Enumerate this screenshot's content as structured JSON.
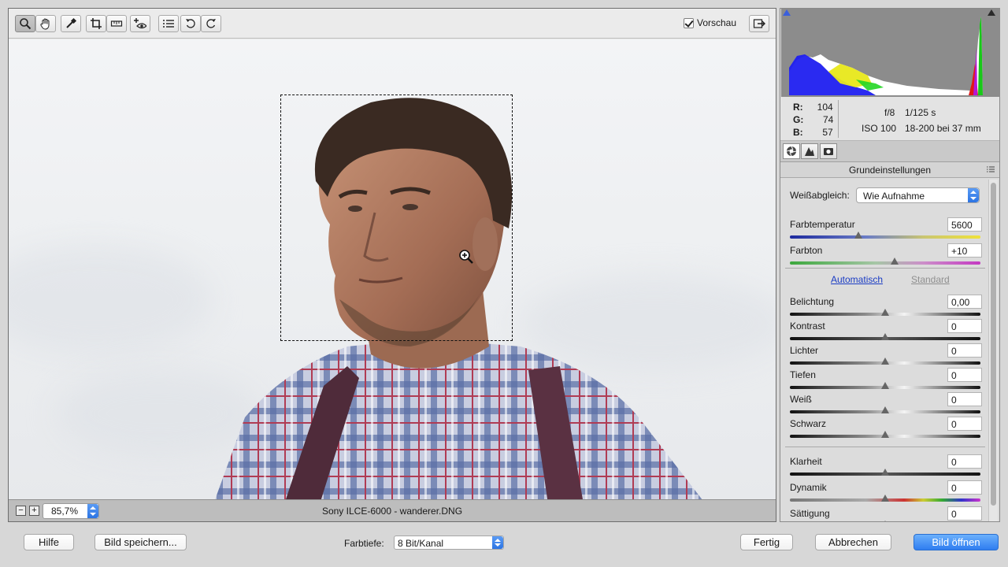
{
  "toolbar": {
    "preview_label": "Vorschau",
    "tools": [
      "zoom-tool",
      "hand-tool",
      "color-sampler-tool",
      "crop-tool",
      "straighten-tool",
      "red-eye-tool",
      "preferences-tool",
      "rotate-ccw-tool",
      "rotate-cw-tool"
    ]
  },
  "statusbar": {
    "zoom_out_label": "−",
    "zoom_in_label": "+",
    "zoom_value": "85,7%",
    "file_info": "Sony ILCE-6000 - wanderer.DNG"
  },
  "info": {
    "r_label": "R:",
    "r_value": "104",
    "g_label": "G:",
    "g_value": "74",
    "b_label": "B:",
    "b_value": "57",
    "aperture": "f/8",
    "shutter": "1/125 s",
    "iso": "ISO 100",
    "lens": "18-200 bei 37 mm"
  },
  "panel": {
    "section_title": "Grundeinstellungen",
    "wb_label": "Weißabgleich:",
    "wb_value": "Wie Aufnahme",
    "auto_label": "Automatisch",
    "default_label": "Standard",
    "sliders": [
      {
        "label": "Farbtemperatur",
        "value": "5600",
        "position": 0.36
      },
      {
        "label": "Farbton",
        "value": "+10",
        "position": 0.55
      },
      {
        "label": "Belichtung",
        "value": "0,00",
        "position": 0.5
      },
      {
        "label": "Kontrast",
        "value": "0",
        "position": 0.5
      },
      {
        "label": "Lichter",
        "value": "0",
        "position": 0.5
      },
      {
        "label": "Tiefen",
        "value": "0",
        "position": 0.5
      },
      {
        "label": "Weiß",
        "value": "0",
        "position": 0.5
      },
      {
        "label": "Schwarz",
        "value": "0",
        "position": 0.5
      },
      {
        "label": "Klarheit",
        "value": "0",
        "position": 0.5
      },
      {
        "label": "Dynamik",
        "value": "0",
        "position": 0.5
      },
      {
        "label": "Sättigung",
        "value": "0",
        "position": 0.5
      }
    ]
  },
  "bottom": {
    "help_label": "Hilfe",
    "save_label": "Bild speichern...",
    "bitdepth_label": "Farbtiefe:",
    "bitdepth_value": "8 Bit/Kanal",
    "done_label": "Fertig",
    "cancel_label": "Abbrechen",
    "open_label": "Bild öffnen"
  },
  "colors": {
    "accent": "#2f7df0",
    "link": "#1a3cc4"
  }
}
